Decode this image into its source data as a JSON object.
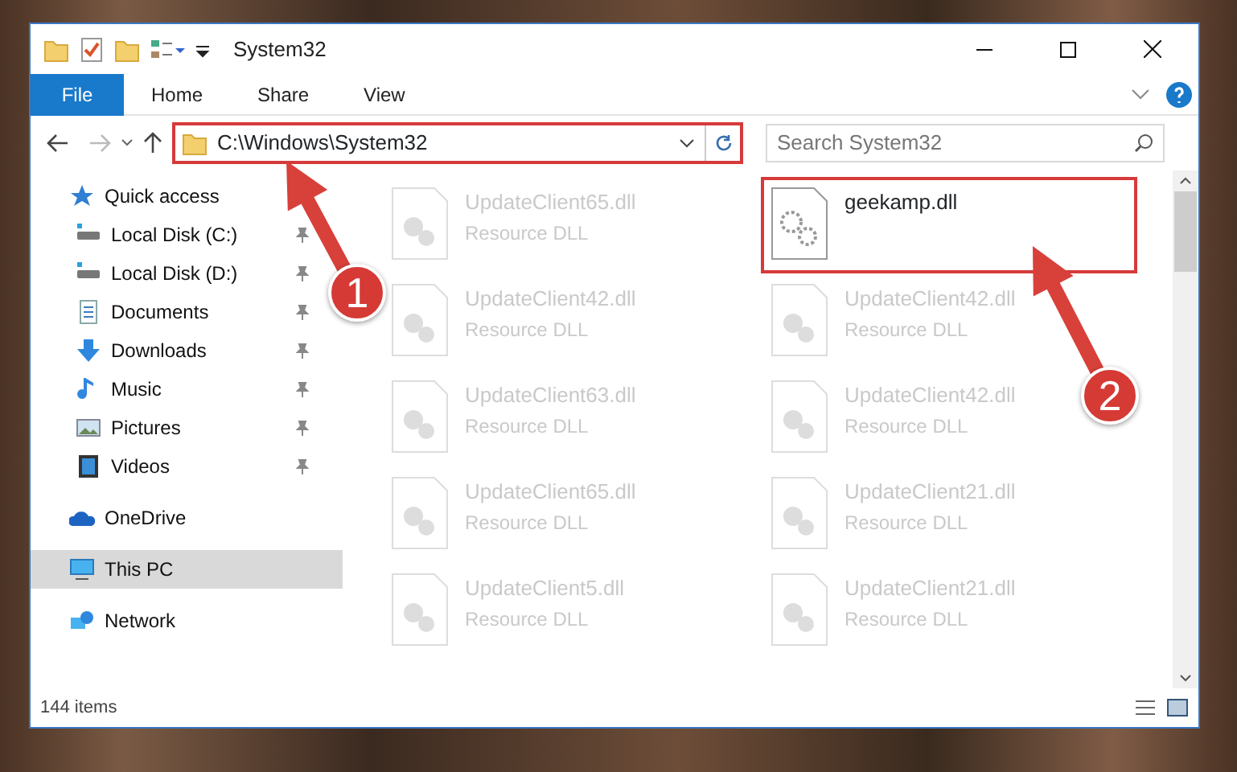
{
  "window": {
    "title": "System32"
  },
  "ribbon_tabs": [
    {
      "label": "File",
      "selected": true
    },
    {
      "label": "Home",
      "selected": false
    },
    {
      "label": "Share",
      "selected": false
    },
    {
      "label": "View",
      "selected": false
    }
  ],
  "address_bar": {
    "path": "C:\\Windows\\System32"
  },
  "search": {
    "placeholder": "Search System32"
  },
  "sidebar": {
    "items": [
      {
        "label": "Quick access",
        "kind": "star",
        "selected": false,
        "children": [
          {
            "label": "Local Disk (C:)",
            "kind": "drive",
            "pinned": true,
            "selected": false
          },
          {
            "label": "Local Disk (D:)",
            "kind": "drive",
            "pinned": true,
            "selected": false
          },
          {
            "label": "Documents",
            "kind": "documents",
            "pinned": true,
            "selected": false
          },
          {
            "label": "Downloads",
            "kind": "downloads",
            "pinned": true,
            "selected": false
          },
          {
            "label": "Music",
            "kind": "music",
            "pinned": true,
            "selected": false
          },
          {
            "label": "Pictures",
            "kind": "pictures",
            "pinned": true,
            "selected": false
          },
          {
            "label": "Videos",
            "kind": "videos",
            "pinned": true,
            "selected": false
          }
        ]
      },
      {
        "label": "OneDrive",
        "kind": "cloud",
        "selected": false
      },
      {
        "label": "This PC",
        "kind": "computer",
        "selected": true
      },
      {
        "label": "Network",
        "kind": "network",
        "selected": false
      }
    ]
  },
  "files": [
    {
      "name": "UpdateClient65.dll",
      "type": "Resource DLL",
      "dimmed": true
    },
    {
      "name": "geekamp.dll",
      "dimmed": false
    },
    {
      "name": "UpdateClient42.dll",
      "type": "Resource DLL",
      "dimmed": true
    },
    {
      "name": "UpdateClient42.dll",
      "type": "Resource DLL",
      "dimmed": true
    },
    {
      "name": "UpdateClient63.dll",
      "type": "Resource DLL",
      "dimmed": true
    },
    {
      "name": "UpdateClient42.dll",
      "type": "Resource DLL",
      "dimmed": true
    },
    {
      "name": "UpdateClient65.dll",
      "type": "Resource DLL",
      "dimmed": true
    },
    {
      "name": "UpdateClient21.dll",
      "type": "Resource DLL",
      "dimmed": true
    },
    {
      "name": "UpdateClient5.dll",
      "type": "Resource DLL",
      "dimmed": true
    },
    {
      "name": "UpdateClient21.dll",
      "type": "Resource DLL",
      "dimmed": true
    }
  ],
  "status_bar": {
    "count": "144 items"
  },
  "annotations": [
    {
      "number": "1"
    },
    {
      "number": "2"
    }
  ]
}
